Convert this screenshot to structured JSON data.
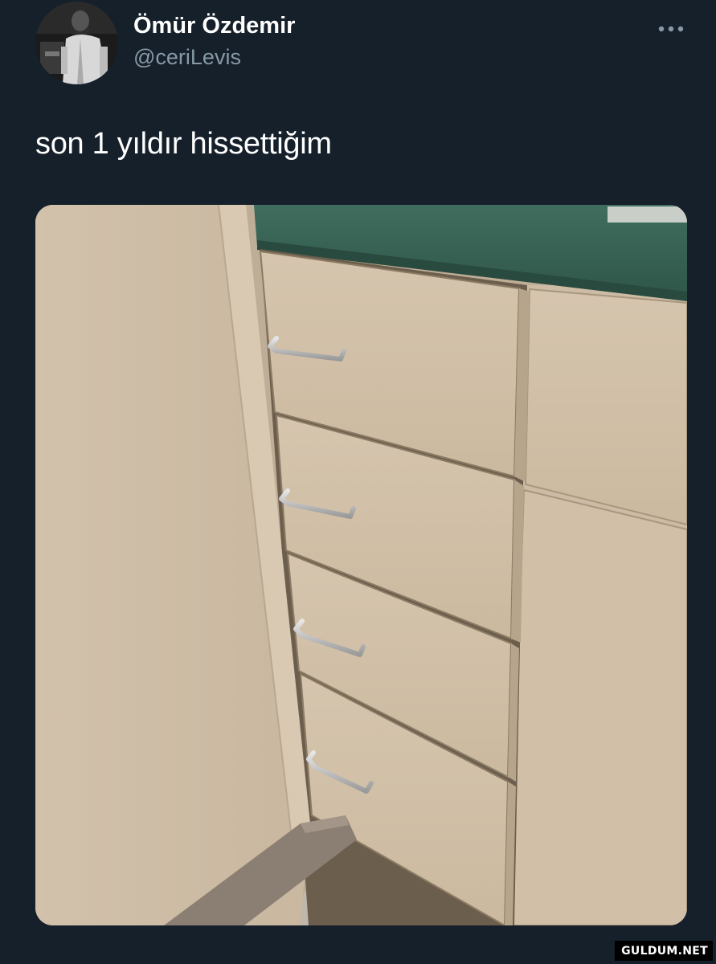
{
  "tweet": {
    "author": {
      "display_name": "Ömür Özdemir",
      "handle": "@ceriLevis",
      "avatar_icon": "profile-photo"
    },
    "more_icon": "more-horizontal-icon",
    "text": "son 1 yıldır hissettiğim",
    "media": {
      "kind": "photo",
      "subject_icon": "drawers-photo"
    }
  },
  "watermark": "GULDUM.NET",
  "colors": {
    "background": "#15202b",
    "text_primary": "#ffffff",
    "text_secondary": "#8899a6"
  }
}
